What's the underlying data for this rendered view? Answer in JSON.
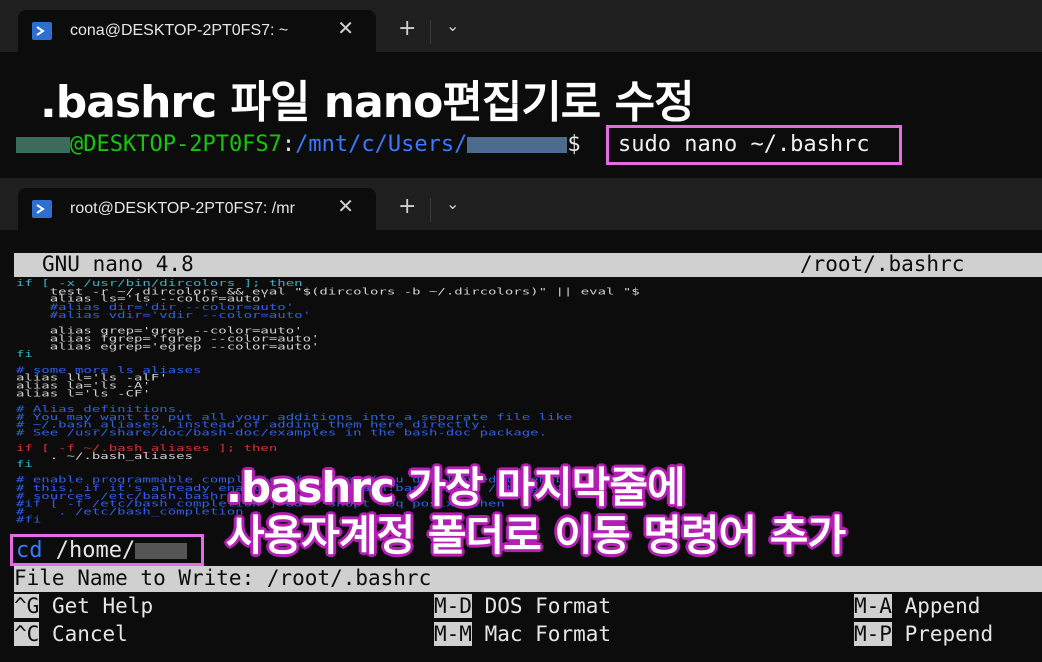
{
  "window1": {
    "tab_title": "cona@DESKTOP-2PT0FS7: ~",
    "close_glyph": "✕",
    "newtab_glyph": "+",
    "dropdown_glyph": "⌄"
  },
  "caption_top": ".bashrc 파일 nano편집기로 수정",
  "prompt": {
    "user_host": "@DESKTOP-2PT0FS7",
    "colon": ":",
    "path": "/mnt/c/Users/",
    "dollar": "$",
    "command": "sudo nano ~/.bashrc"
  },
  "window2": {
    "tab_title": "root@DESKTOP-2PT0FS7: /mr",
    "close_glyph": "✕",
    "newtab_glyph": "+",
    "dropdown_glyph": "⌄"
  },
  "nano": {
    "version": "GNU nano 4.8",
    "filename": "/root/.bashrc",
    "code_lines": [
      [
        "cy",
        "if [ -x /usr/bin/dircolors ]; then"
      ],
      [
        "wh",
        "    test -r ~/.dircolors && eval \"$(dircolors -b ~/.dircolors)\" || eval \"$"
      ],
      [
        "wh",
        "    alias ls='ls --color=auto'"
      ],
      [
        "bl",
        "    #alias dir='dir --color=auto'"
      ],
      [
        "bl",
        "    #alias vdir='vdir --color=auto'"
      ],
      [
        "wh",
        ""
      ],
      [
        "wh",
        "    alias grep='grep --color=auto'"
      ],
      [
        "wh",
        "    alias fgrep='fgrep --color=auto'"
      ],
      [
        "wh",
        "    alias egrep='egrep --color=auto'"
      ],
      [
        "cy",
        "fi"
      ],
      [
        "wh",
        ""
      ],
      [
        "bl",
        "# some more ls aliases"
      ],
      [
        "wh",
        "alias ll='ls -alF'"
      ],
      [
        "wh",
        "alias la='ls -A'"
      ],
      [
        "wh",
        "alias l='ls -CF'"
      ],
      [
        "wh",
        ""
      ],
      [
        "bl",
        "# Alias definitions."
      ],
      [
        "bl",
        "# You may want to put all your additions into a separate file like"
      ],
      [
        "bl",
        "# ~/.bash_aliases, instead of adding them here directly."
      ],
      [
        "bl",
        "# See /usr/share/doc/bash-doc/examples in the bash-doc package."
      ],
      [
        "wh",
        ""
      ],
      [
        "rd",
        "if [ -f ~/.bash_aliases ]; then"
      ],
      [
        "wh",
        "    . ~/.bash_aliases"
      ],
      [
        "cy",
        "fi"
      ],
      [
        "wh",
        ""
      ],
      [
        "bl",
        "# enable programmable completion features (you don't need to enable"
      ],
      [
        "bl",
        "# this, if it's already enabled in /etc/bash.bashrc and /etc/profile"
      ],
      [
        "bl",
        "# sources /etc/bash.bashrc)."
      ],
      [
        "bl",
        "#if [ -f /etc/bash_completion ] && ! shopt -oq posix; then"
      ],
      [
        "bl",
        "#    . /etc/bash_completion"
      ],
      [
        "bl",
        "#fi"
      ]
    ],
    "cd_keyword": "cd",
    "cd_path": "/home/",
    "filename_prompt": "File Name to Write: /root/.bashrc",
    "shortcuts": [
      {
        "key": "^G",
        "label": "Get Help"
      },
      {
        "key": "M-D",
        "label": "DOS Format"
      },
      {
        "key": "M-A",
        "label": "Append"
      },
      {
        "key": "^C",
        "label": "Cancel"
      },
      {
        "key": "M-M",
        "label": "Mac Format"
      },
      {
        "key": "M-P",
        "label": "Prepend"
      }
    ]
  },
  "caption_bottom_1": ".bashrc 가장 마지막줄에",
  "caption_bottom_2": "사용자계정 폴더로 이동 명령어 추가",
  "colors": {
    "highlight_box": "#e36be3",
    "caption_outline": "#b51fb5",
    "prompt_green": "#16c60c",
    "prompt_blue": "#3b78ff"
  }
}
